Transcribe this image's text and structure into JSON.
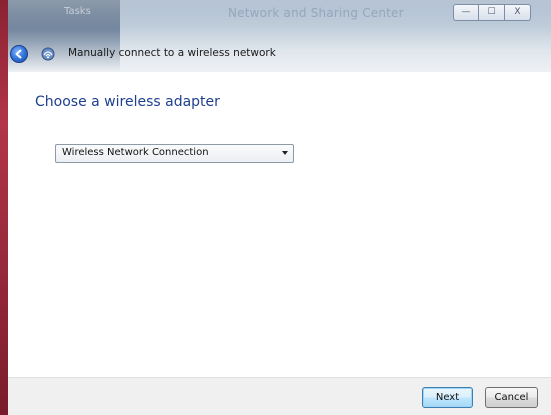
{
  "window": {
    "ghost_left_text": "Tasks",
    "ghost_title": "Network and Sharing Center",
    "caption": {
      "minimize_glyph": "—",
      "maximize_glyph": "☐",
      "close_glyph": "X"
    }
  },
  "wizard": {
    "title": "Manually connect to a wireless network",
    "back_icon": "back-arrow-icon",
    "app_icon": "wireless-network-icon"
  },
  "content": {
    "heading": "Choose a wireless adapter",
    "adapter_select": {
      "selected": "Wireless Network Connection"
    }
  },
  "footer": {
    "next_label": "Next",
    "cancel_label": "Cancel"
  },
  "colors": {
    "heading": "#1f3f8f",
    "frame_red": "#9a2a3d",
    "footer_bg": "#f0f0f0"
  }
}
